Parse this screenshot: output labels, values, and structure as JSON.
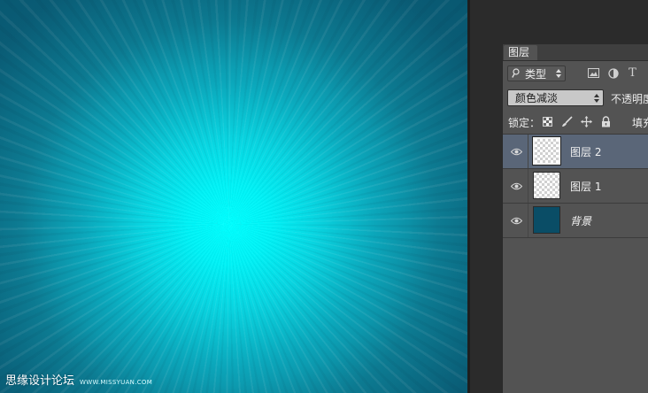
{
  "canvas": {
    "watermark_cn": "思缘设计论坛",
    "watermark_url": "WWW.MISSYUAN.COM"
  },
  "layers_panel": {
    "tab_label": "图层",
    "filter": {
      "selected": "类型",
      "icons": [
        "image-filter-icon",
        "adjustment-filter-icon",
        "type-filter-icon"
      ],
      "type_glyph": "T"
    },
    "blend_mode": {
      "selected": "颜色减淡"
    },
    "opacity_label": "不透明度",
    "lock_label": "锁定：",
    "fill_label": "填充",
    "layers": [
      {
        "name": "图层 2",
        "visible": true,
        "selected": true,
        "thumb": "transparent"
      },
      {
        "name": "图层 1",
        "visible": true,
        "selected": false,
        "thumb": "transparent"
      },
      {
        "name": "背景",
        "visible": true,
        "selected": false,
        "thumb": "solid"
      }
    ]
  },
  "colors": {
    "panel_bg": "#535353",
    "selected_row": "#5a6678",
    "canvas_glow": "#00ffff",
    "background_layer": "#0a4d66"
  }
}
